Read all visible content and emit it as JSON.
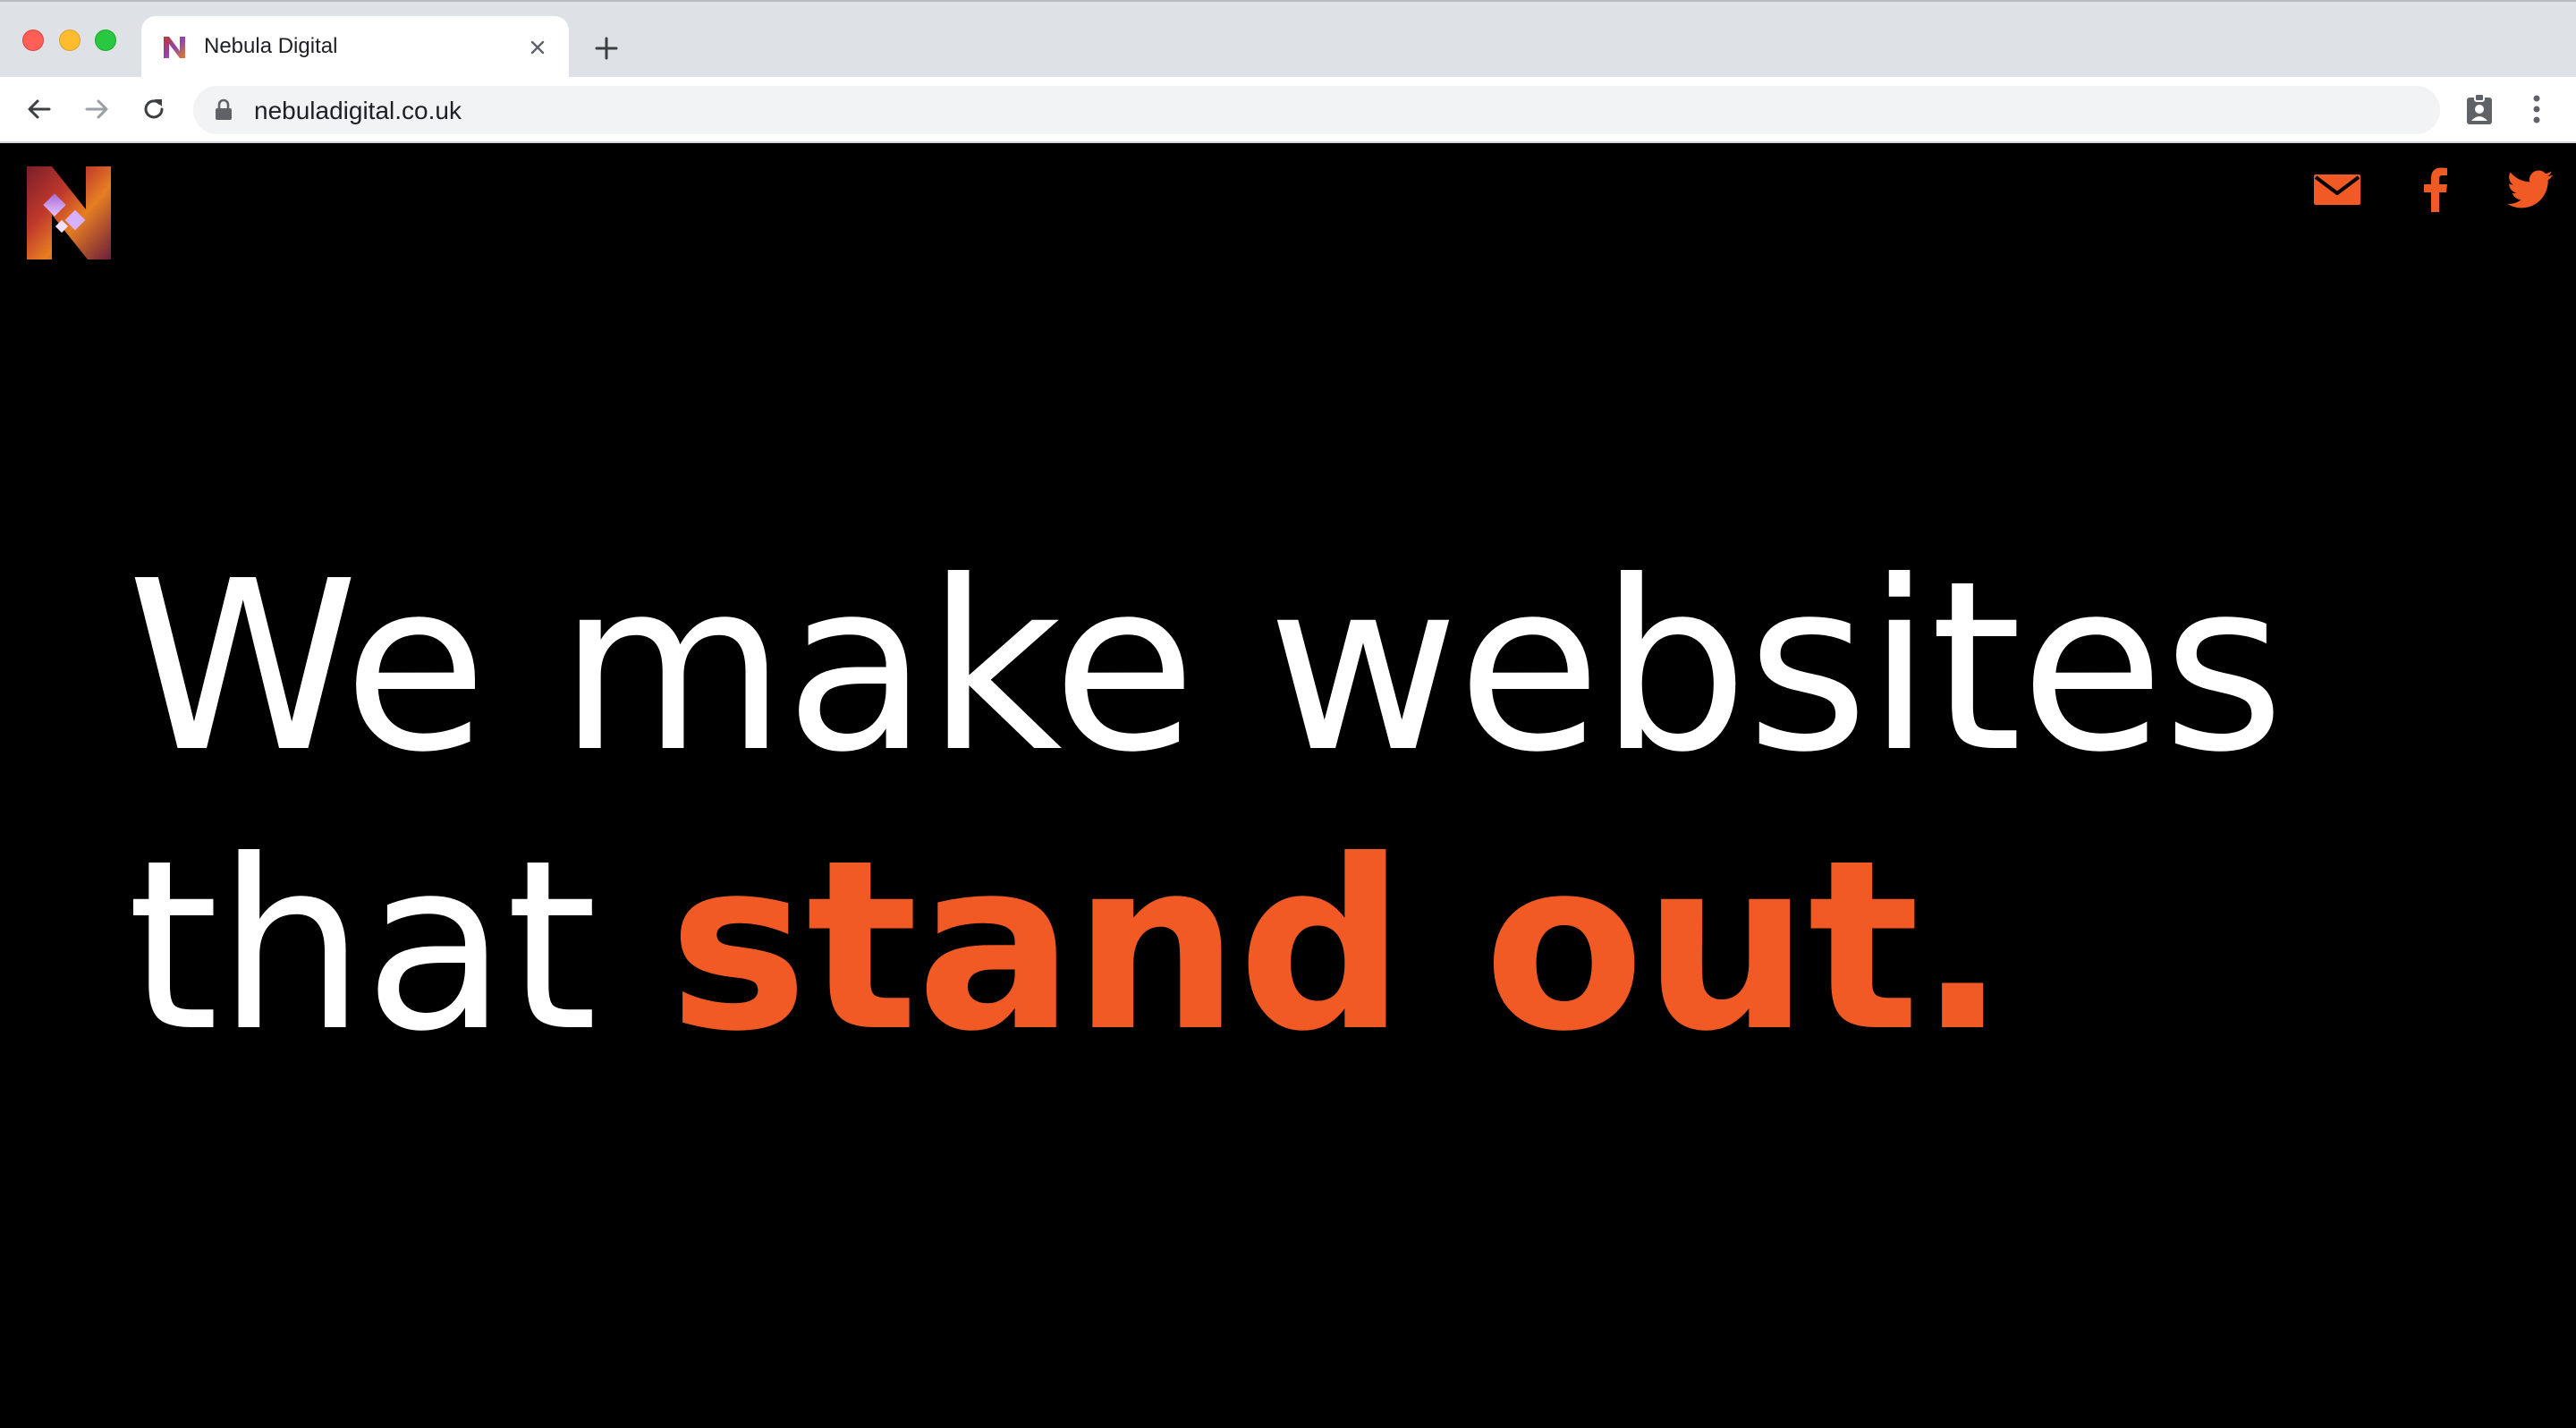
{
  "browser": {
    "tab": {
      "title": "Nebula Digital"
    },
    "address_bar": {
      "url": "nebuladigital.co.uk"
    }
  },
  "site": {
    "brand_accent_color": "#f15a24",
    "social_icons": [
      "mail-icon",
      "facebook-icon",
      "twitter-icon"
    ],
    "hero": {
      "line1": "We make websites",
      "line2_prefix": "that",
      "line2_accent": "stand out."
    }
  }
}
